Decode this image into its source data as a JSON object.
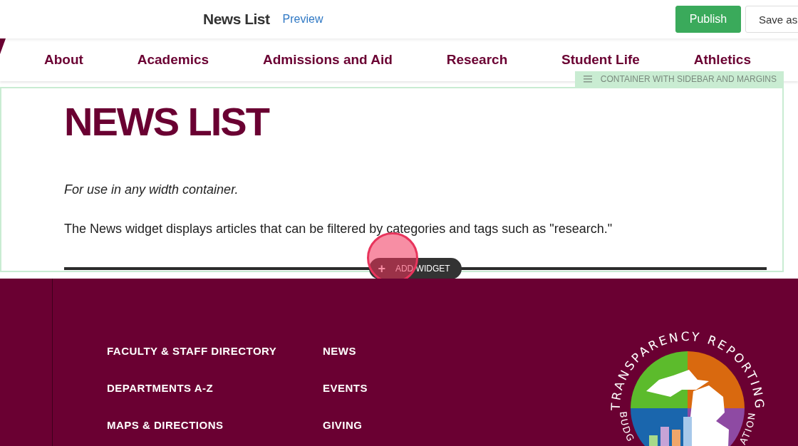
{
  "editor_bar": {
    "title": "News List",
    "preview_link": "Preview",
    "buttons": [
      {
        "label": "Publish",
        "kind": "primary"
      },
      {
        "label": "Save as",
        "kind": "secondary"
      }
    ]
  },
  "nav": {
    "items": [
      "About",
      "Academics",
      "Admissions and Aid",
      "Research",
      "Student Life",
      "Athletics"
    ]
  },
  "container": {
    "label": "CONTAINER WITH SIDEBAR AND MARGINS",
    "heading": "NEWS LIST",
    "note": "For use in any width container.",
    "description": "The News widget displays articles that can be filtered by categories and tags such as \"research.\"",
    "add_widget": {
      "icon": "+",
      "label": "ADD WIDGET"
    }
  },
  "footer": {
    "columns": [
      [
        "FACULTY & STAFF DIRECTORY",
        "DEPARTMENTS A-Z",
        "MAPS & DIRECTIONS"
      ],
      [
        "NEWS",
        "EVENTS",
        "GIVING"
      ]
    ],
    "logo": {
      "top_text": "TRANSPARENCY REPORTING",
      "bottom_left_text": "BUDG",
      "bottom_right_text": "ATION"
    }
  }
}
